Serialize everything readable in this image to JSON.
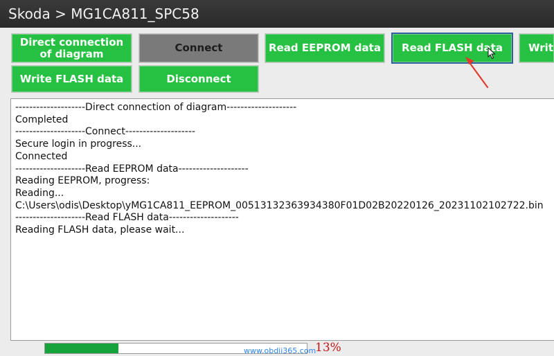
{
  "window": {
    "title": "Skoda > MG1CA811_SPC58"
  },
  "toolbar": {
    "direct_connection_label": "Direct connection of diagram",
    "connect_label": "Connect",
    "read_eeprom_label": "Read EEPROM data",
    "read_flash_label": "Read FLASH data",
    "write_partial_label": "Write",
    "write_flash_label": "Write FLASH data",
    "disconnect_label": "Disconnect"
  },
  "log": {
    "lines": [
      "--------------------Direct connection of diagram--------------------",
      "Completed",
      "--------------------Connect--------------------",
      "Secure login in progress...",
      "Connected",
      "--------------------Read EEPROM data--------------------",
      "Reading EEPROM, progress:",
      "Reading...",
      "C:\\Users\\odis\\Desktop\\yMG1CA811_EEPROM_00513132363934380F01D02B20220126_20231102102722.bin",
      "--------------------Read FLASH data--------------------",
      "Reading FLASH data, please wait..."
    ]
  },
  "progress": {
    "fraction": 0.28,
    "percent_label": "13%"
  },
  "watermark": {
    "text": "www.obdii365.com"
  },
  "colors": {
    "button_green": "#26c042",
    "button_gray": "#7a7a7a",
    "progress_green": "#16a33b",
    "annotation_red": "#e23b2e",
    "percent_red": "#c01818"
  },
  "icons": {
    "cursor": "mouse-pointer-icon",
    "annotation": "red-arrow-icon"
  }
}
